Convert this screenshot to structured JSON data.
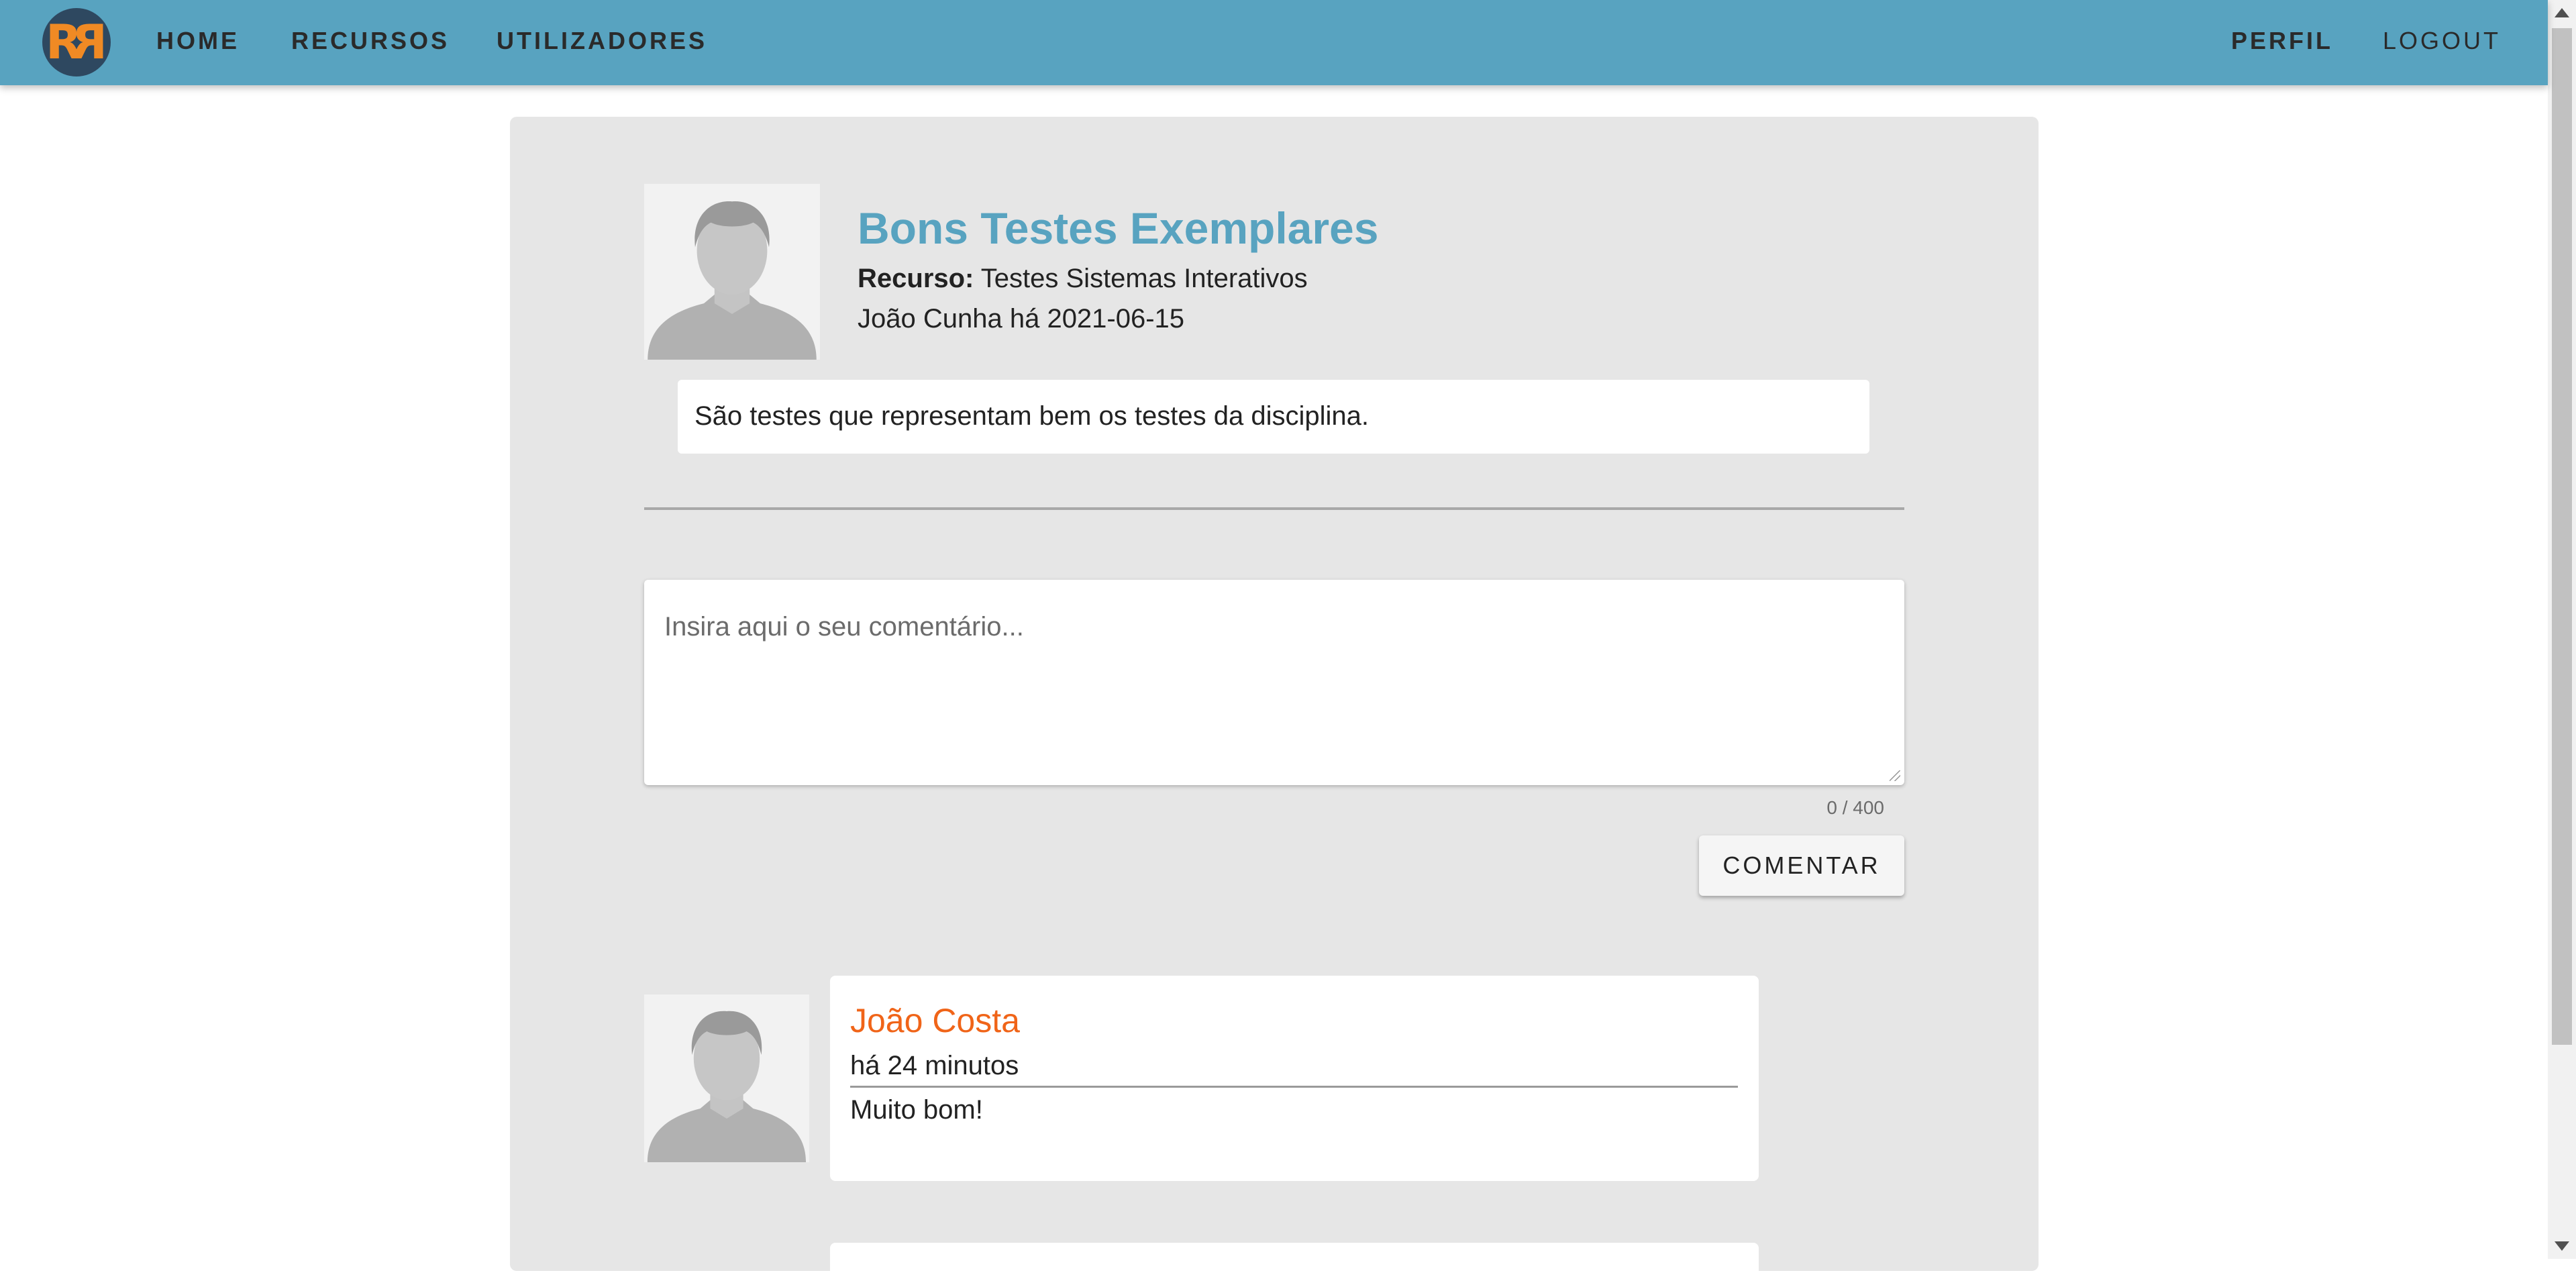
{
  "nav": {
    "logo_text": "RR",
    "home": "HOME",
    "recursos": "RECURSOS",
    "utilizadores": "UTILIZADORES",
    "perfil": "PERFIL",
    "logout": "LOGOUT"
  },
  "post": {
    "title": "Bons Testes Exemplares",
    "resource_label": "Recurso:",
    "resource_name": "Testes Sistemas Interativos",
    "meta": "João Cunha há 2021-06-15",
    "body": "São testes que representam bem os testes da disciplina."
  },
  "comment_form": {
    "placeholder": "Insira aqui o seu comentário...",
    "value": "",
    "char_count": "0 / 400",
    "submit_label": "COMENTAR"
  },
  "comments": [
    {
      "author": "João Costa",
      "time": "há 24 minutos",
      "text": "Muito bom!"
    }
  ],
  "colors": {
    "navbar": "#58a3c0",
    "title": "#58a3c0",
    "comment_author": "#f06418",
    "card": "#e6e6e6",
    "logo_bg": "#2e4860",
    "logo_fg": "#f08a24"
  }
}
